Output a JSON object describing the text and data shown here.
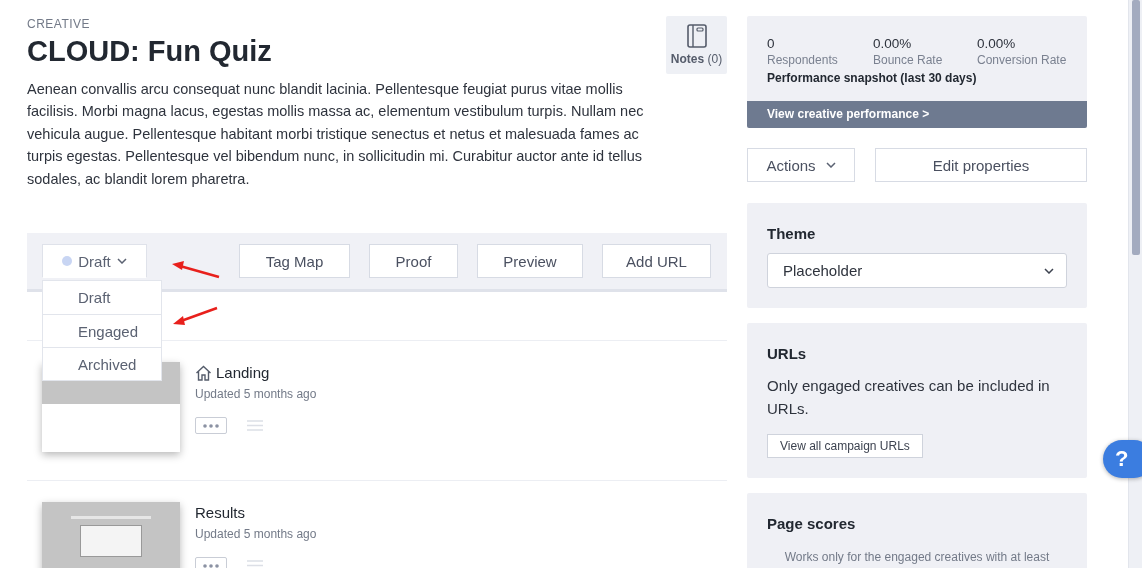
{
  "header": {
    "eyebrow": "CREATIVE",
    "title": "CLOUD: Fun Quiz",
    "description": "Aenean convallis arcu consequat nunc blandit lacinia. Pellentesque feugiat purus vitae mollis facilisis. Morbi magna lacus, egestas mollis massa ac, elementum vestibulum turpis. Nullam nec vehicula augue. Pellentesque habitant morbi tristique senectus et netus et malesuada fames ac turpis egestas. Pellentesque vel bibendum nunc, in sollicitudin mi. Curabitur auctor ante id tellus sodales, ac blandit lorem pharetra."
  },
  "notes": {
    "label": "Notes",
    "count": "(0)"
  },
  "toolbar": {
    "status": {
      "label": "Draft",
      "expanded": true
    },
    "status_options": [
      {
        "label": "Draft"
      },
      {
        "label": "Engaged"
      },
      {
        "label": "Archived"
      }
    ],
    "buttons": [
      "Tag Map",
      "Proof",
      "Preview",
      "Add URL"
    ]
  },
  "pages": [
    {
      "kind": "home",
      "title": "Landing",
      "updated": "Updated 5 months ago"
    },
    {
      "kind": "page",
      "title": "Results",
      "updated": "Updated 5 months ago"
    }
  ],
  "performance": {
    "stats": [
      {
        "value": "0",
        "label": "Respondents"
      },
      {
        "value": "0.00%",
        "label": "Bounce Rate"
      },
      {
        "value": "0.00%",
        "label": "Conversion Rate"
      }
    ],
    "caption": "Performance snapshot (last 30 days)",
    "link": "View creative performance >"
  },
  "actions": {
    "dropdown": "Actions",
    "button": "Edit properties"
  },
  "theme": {
    "title": "Theme",
    "value": "Placeholder"
  },
  "urls": {
    "title": "URLs",
    "text": "Only engaged creatives can be included in URLs.",
    "button": "View all campaign URLs"
  },
  "page_scores": {
    "title": "Page scores",
    "text": "Works only for the engaged creatives with at least"
  },
  "help": {
    "label": "?"
  }
}
